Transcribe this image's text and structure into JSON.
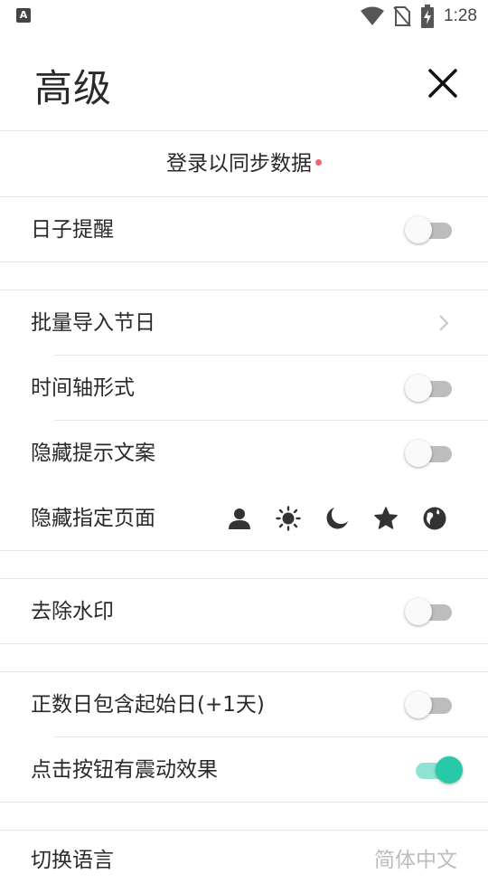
{
  "status_bar": {
    "time": "1:28"
  },
  "header": {
    "title": "高级"
  },
  "login": {
    "label": "登录以同步数据"
  },
  "rows": {
    "day_reminder": "日子提醒",
    "batch_import": "批量导入节日",
    "timeline": "时间轴形式",
    "hide_tips": "隐藏提示文案",
    "hide_pages": "隐藏指定页面",
    "remove_watermark": "去除水印",
    "include_start_day": "正数日包含起始日(+1天)",
    "vibration": "点击按钮有震动效果",
    "language": "切换语言",
    "language_value": "简体中文"
  },
  "toggles": {
    "day_reminder": false,
    "timeline": false,
    "hide_tips": false,
    "remove_watermark": false,
    "include_start_day": false,
    "vibration": true
  },
  "page_icons": [
    "person-icon",
    "sun-icon",
    "moon-icon",
    "star-icon",
    "globe-icon"
  ],
  "colors": {
    "accent": "#27c9a8",
    "accent_track": "#8fe3d2",
    "dot": "#f0666e",
    "toggle_off_track": "#bdbdbd"
  }
}
